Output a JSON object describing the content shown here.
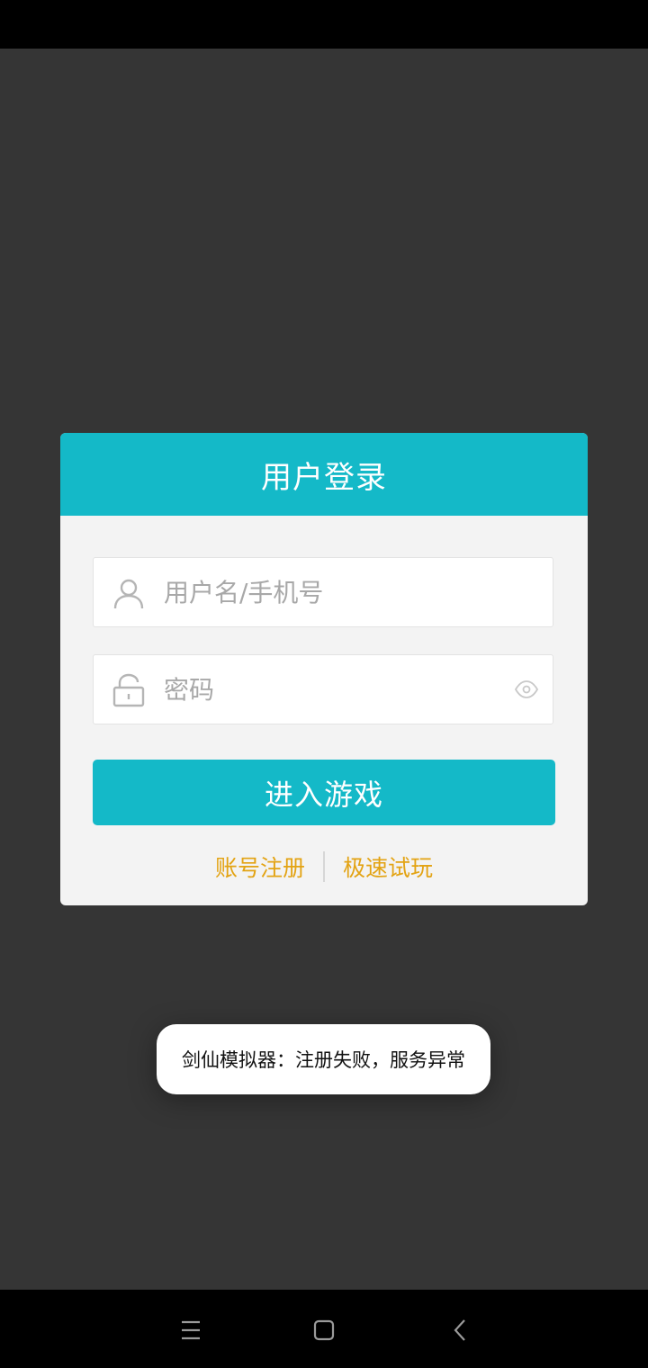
{
  "dialog": {
    "title": "用户登录",
    "username": {
      "placeholder": "用户名/手机号",
      "value": "",
      "icon": "user-icon"
    },
    "password": {
      "placeholder": "密码",
      "value": "",
      "icon": "lock-icon",
      "toggle_icon": "eye-icon"
    },
    "enter_label": "进入游戏",
    "register_label": "账号注册",
    "quick_play_label": "极速试玩"
  },
  "toast": {
    "message": "剑仙模拟器：注册失败，服务异常"
  },
  "colors": {
    "accent": "#14b9c8",
    "link": "#e3a313",
    "background": "#353535"
  },
  "nav": {
    "icons": [
      "menu-icon",
      "home-icon",
      "back-icon"
    ]
  }
}
